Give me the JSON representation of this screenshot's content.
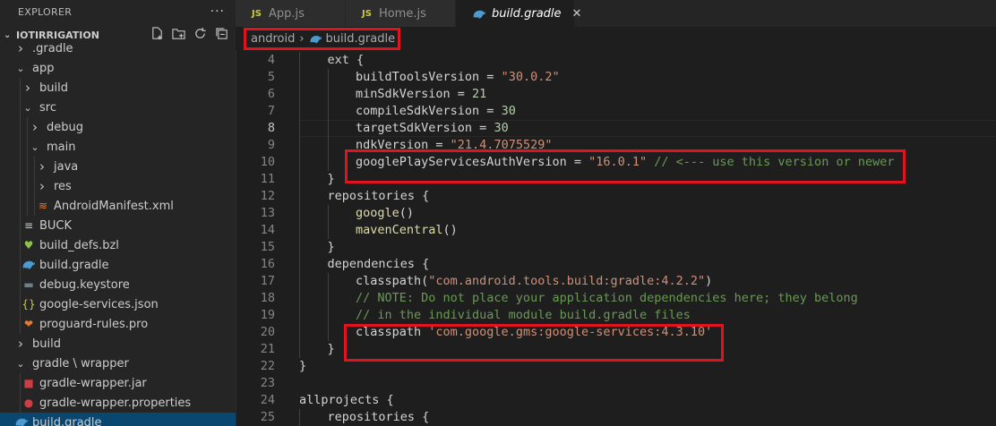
{
  "explorer": {
    "title": "EXPLORER",
    "more": "···",
    "project": "IOTIRRIGATION",
    "items": [
      {
        "label": ".gradle",
        "indent": 2,
        "kind": "folder",
        "open": false
      },
      {
        "label": "app",
        "indent": 2,
        "kind": "folder",
        "open": true
      },
      {
        "label": "build",
        "indent": 3,
        "kind": "folder",
        "open": false
      },
      {
        "label": "src",
        "indent": 3,
        "kind": "folder",
        "open": true
      },
      {
        "label": "debug",
        "indent": 4,
        "kind": "folder",
        "open": false
      },
      {
        "label": "main",
        "indent": 4,
        "kind": "folder",
        "open": true
      },
      {
        "label": "java",
        "indent": 5,
        "kind": "folder",
        "open": false
      },
      {
        "label": "res",
        "indent": 5,
        "kind": "folder",
        "open": false
      },
      {
        "label": "AndroidManifest.xml",
        "indent": 5,
        "kind": "xml"
      },
      {
        "label": "BUCK",
        "indent": 3,
        "kind": "buck"
      },
      {
        "label": "build_defs.bzl",
        "indent": 3,
        "kind": "bzl"
      },
      {
        "label": "build.gradle",
        "indent": 3,
        "kind": "gradle"
      },
      {
        "label": "debug.keystore",
        "indent": 3,
        "kind": "keystore"
      },
      {
        "label": "google-services.json",
        "indent": 3,
        "kind": "json"
      },
      {
        "label": "proguard-rules.pro",
        "indent": 3,
        "kind": "pro"
      },
      {
        "label": "build",
        "indent": 2,
        "kind": "folder",
        "open": false
      },
      {
        "label": "gradle \\ wrapper",
        "indent": 2,
        "kind": "folder",
        "open": true
      },
      {
        "label": "gradle-wrapper.jar",
        "indent": 3,
        "kind": "jar"
      },
      {
        "label": "gradle-wrapper.properties",
        "indent": 3,
        "kind": "properties"
      },
      {
        "label": "build.gradle",
        "indent": 2,
        "kind": "gradle",
        "selected": true
      }
    ]
  },
  "tabs": [
    {
      "label": "App.js",
      "icon": "JS",
      "active": false
    },
    {
      "label": "Home.js",
      "icon": "JS",
      "active": false
    },
    {
      "label": "build.gradle",
      "icon": "gradle",
      "active": true,
      "close": "✕"
    }
  ],
  "breadcrumb": {
    "parts": [
      "android",
      "build.gradle"
    ],
    "sep": "›"
  },
  "editor": {
    "current_line": 8,
    "lines": [
      {
        "n": 4,
        "indent": 1,
        "tokens": [
          [
            "p",
            "ext {"
          ]
        ]
      },
      {
        "n": 5,
        "indent": 2,
        "tokens": [
          [
            "p",
            "buildToolsVersion = "
          ],
          [
            "s",
            "\"30.0.2\""
          ]
        ]
      },
      {
        "n": 6,
        "indent": 2,
        "tokens": [
          [
            "p",
            "minSdkVersion = "
          ],
          [
            "n",
            "21"
          ]
        ]
      },
      {
        "n": 7,
        "indent": 2,
        "tokens": [
          [
            "p",
            "compileSdkVersion = "
          ],
          [
            "n",
            "30"
          ]
        ]
      },
      {
        "n": 8,
        "indent": 2,
        "tokens": [
          [
            "p",
            "targetSdkVersion = "
          ],
          [
            "n",
            "30"
          ]
        ]
      },
      {
        "n": 9,
        "indent": 2,
        "tokens": [
          [
            "p",
            "ndkVersion = "
          ],
          [
            "s",
            "\"21.4.7075529\""
          ]
        ]
      },
      {
        "n": 10,
        "indent": 2,
        "tokens": [
          [
            "p",
            "googlePlayServicesAuthVersion = "
          ],
          [
            "s",
            "\"16.0.1\""
          ],
          [
            "c",
            " // <--- use this version or newer"
          ]
        ]
      },
      {
        "n": 11,
        "indent": 1,
        "tokens": [
          [
            "p",
            "}"
          ]
        ]
      },
      {
        "n": 12,
        "indent": 1,
        "tokens": [
          [
            "p",
            "repositories {"
          ]
        ]
      },
      {
        "n": 13,
        "indent": 2,
        "tokens": [
          [
            "f",
            "google"
          ],
          [
            "p",
            "()"
          ]
        ]
      },
      {
        "n": 14,
        "indent": 2,
        "tokens": [
          [
            "f",
            "mavenCentral"
          ],
          [
            "p",
            "()"
          ]
        ]
      },
      {
        "n": 15,
        "indent": 1,
        "tokens": [
          [
            "p",
            "}"
          ]
        ]
      },
      {
        "n": 16,
        "indent": 1,
        "tokens": [
          [
            "p",
            "dependencies {"
          ]
        ]
      },
      {
        "n": 17,
        "indent": 2,
        "tokens": [
          [
            "p",
            "classpath("
          ],
          [
            "s",
            "\"com.android.tools.build:gradle:4.2.2\""
          ],
          [
            "p",
            ")"
          ]
        ]
      },
      {
        "n": 18,
        "indent": 2,
        "tokens": [
          [
            "c",
            "// NOTE: Do not place your application dependencies here; they belong"
          ]
        ]
      },
      {
        "n": 19,
        "indent": 2,
        "tokens": [
          [
            "c",
            "// in the individual module build.gradle files"
          ]
        ]
      },
      {
        "n": 20,
        "indent": 2,
        "tokens": [
          [
            "p",
            "classpath "
          ],
          [
            "s",
            "'com.google.gms:google-services:4.3.10'"
          ]
        ]
      },
      {
        "n": 21,
        "indent": 1,
        "tokens": [
          [
            "p",
            "}"
          ]
        ]
      },
      {
        "n": 22,
        "indent": 0,
        "tokens": [
          [
            "p",
            "}"
          ]
        ]
      },
      {
        "n": 23,
        "indent": 0,
        "tokens": []
      },
      {
        "n": 24,
        "indent": 0,
        "tokens": [
          [
            "p",
            "allprojects {"
          ]
        ]
      },
      {
        "n": 25,
        "indent": 1,
        "tokens": [
          [
            "p",
            "repositories {"
          ]
        ]
      }
    ]
  },
  "colors": {
    "highlight_box": "#e0141f",
    "selection": "#094771",
    "gradle_icon": "#4b9bd1"
  }
}
